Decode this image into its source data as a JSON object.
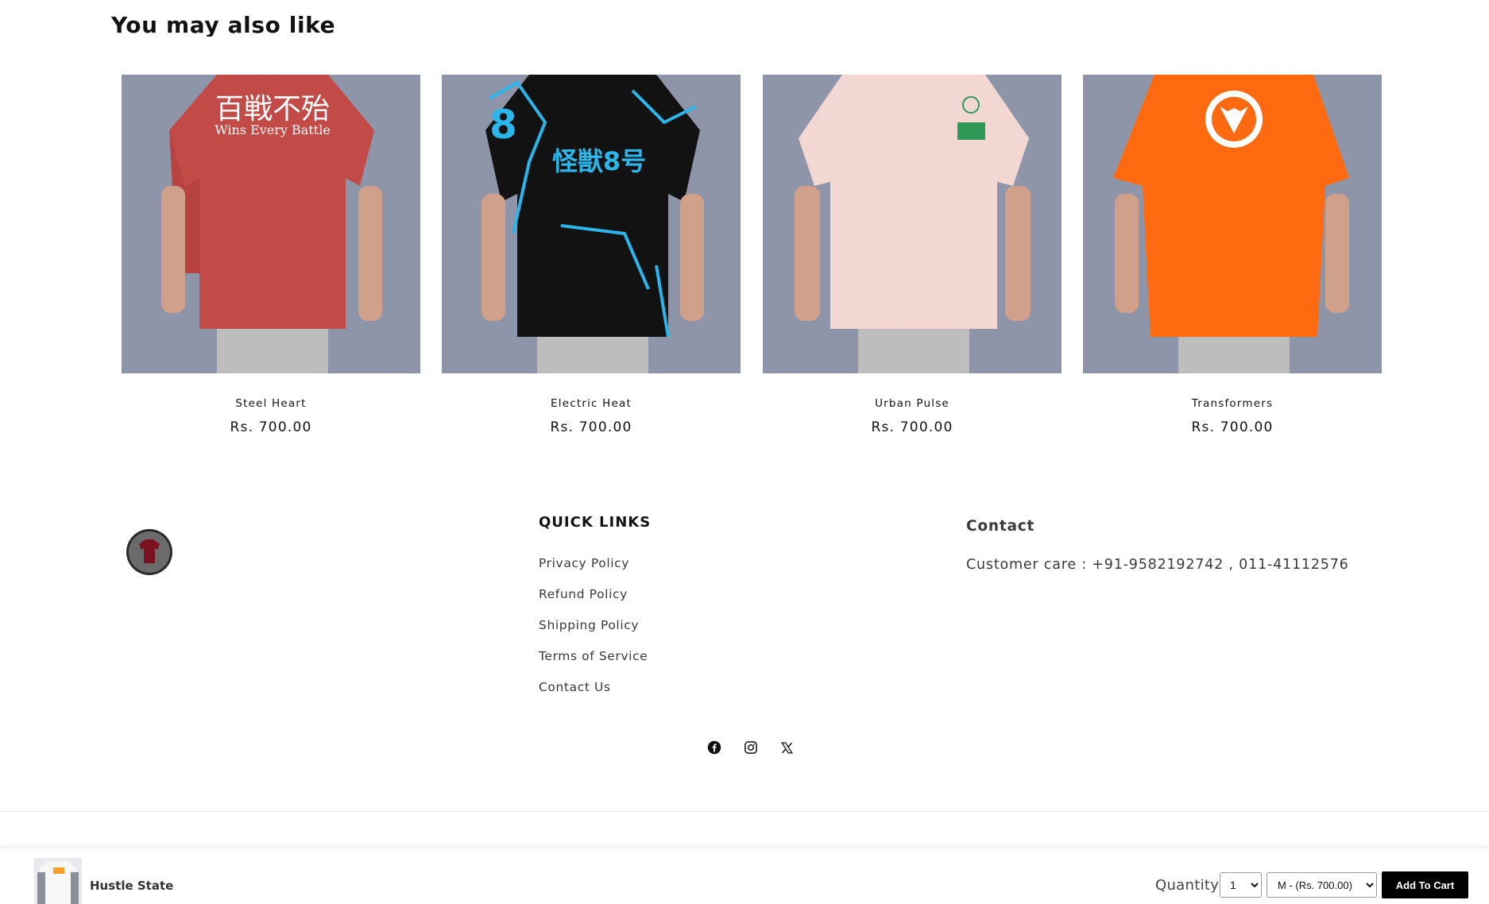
{
  "section": {
    "heading": "You may also like"
  },
  "products": [
    {
      "name": "Steel Heart",
      "price": "Rs. 700.00",
      "shirt_color": "#c24a47",
      "print_line1": "百戦不殆",
      "print_line2": "Wins Every Battle"
    },
    {
      "name": "Electric Heat",
      "price": "Rs. 700.00",
      "shirt_color": "#111111",
      "print_line1": "怪獣8号",
      "print_line2": ""
    },
    {
      "name": "Urban Pulse",
      "price": "Rs. 700.00",
      "shirt_color": "#f2d7d2",
      "print_line1": "",
      "print_line2": ""
    },
    {
      "name": "Transformers",
      "price": "Rs. 700.00",
      "shirt_color": "#ff6a10",
      "print_line1": "",
      "print_line2": ""
    }
  ],
  "footer": {
    "logo_icon": "brand-logo-icon",
    "quick_links_heading": "QUICK LINKS",
    "quick_links": [
      "Privacy Policy",
      "Refund Policy",
      "Shipping Policy",
      "Terms of Service",
      "Contact Us"
    ],
    "contact_heading": "Contact",
    "contact_line": "Customer care : +91-9582192742 , 011-41112576",
    "social_icons": [
      "facebook-icon",
      "instagram-icon",
      "x-twitter-icon"
    ]
  },
  "sticky_cart": {
    "product_title": "Hustle State",
    "quantity_label": "Quantity",
    "quantity_value": "1",
    "variant_value": "M - (Rs. 700.00)",
    "button_label": "Add To Cart"
  },
  "colors": {
    "background": "#ffffff",
    "text": "#121212",
    "button_bg": "#000000",
    "button_text": "#ffffff"
  }
}
